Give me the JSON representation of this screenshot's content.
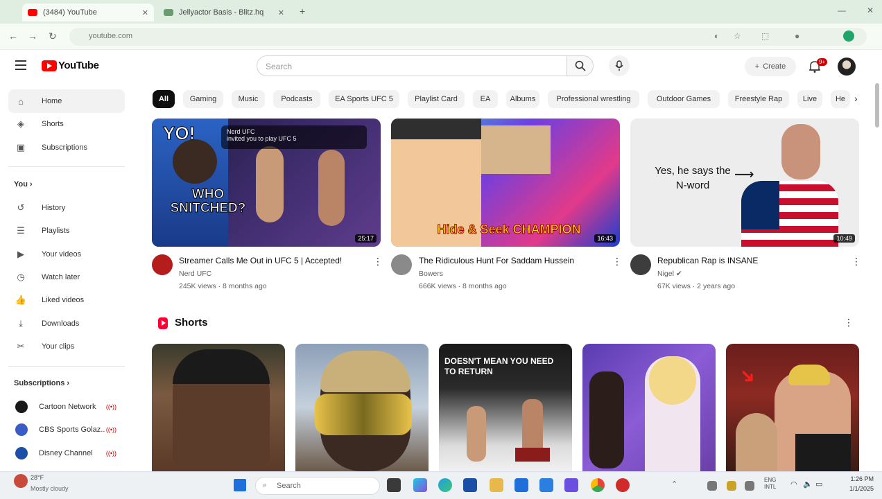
{
  "browser": {
    "tabs": [
      {
        "title": "(3484) YouTube",
        "active": true
      },
      {
        "title": "Jellyactor Basis - Blitz.hq",
        "active": false
      }
    ],
    "url": "youtube.com"
  },
  "header": {
    "logo_text": "YouTube",
    "search_placeholder": "Search",
    "create_label": "Create",
    "notification_count": "9+"
  },
  "sidebar": {
    "main": [
      {
        "label": "Home",
        "icon": "home-icon",
        "active": true
      },
      {
        "label": "Shorts",
        "icon": "shorts-icon"
      },
      {
        "label": "Subscriptions",
        "icon": "subscriptions-icon"
      }
    ],
    "you_heading": "You",
    "you_items": [
      {
        "label": "History",
        "icon": "history-icon"
      },
      {
        "label": "Playlists",
        "icon": "playlists-icon"
      },
      {
        "label": "Your videos",
        "icon": "your-videos-icon"
      },
      {
        "label": "Watch later",
        "icon": "watch-later-icon"
      },
      {
        "label": "Liked videos",
        "icon": "liked-videos-icon"
      },
      {
        "label": "Downloads",
        "icon": "downloads-icon"
      },
      {
        "label": "Your clips",
        "icon": "clips-icon"
      }
    ],
    "subscriptions_heading": "Subscriptions",
    "subscriptions": [
      {
        "label": "Cartoon Network",
        "color": "#1a1a1a",
        "live": "((•))"
      },
      {
        "label": "CBS Sports Golaz..",
        "color": "#3b5cc4",
        "live": "((•))"
      },
      {
        "label": "Disney Channel",
        "color": "#1c4fa8",
        "live": "((•))"
      }
    ]
  },
  "chips": [
    "All",
    "Gaming",
    "Music",
    "Podcasts",
    "EA Sports UFC 5",
    "Playlist Card",
    "EA",
    "Albums",
    "Professional wrestling",
    "Outdoor Games",
    "Freestyle Rap",
    "Live",
    "He"
  ],
  "videos": [
    {
      "title": "Streamer Calls Me Out in UFC 5 | Accepted!",
      "channel": "Nerd UFC",
      "meta": "245K views · 8 months ago",
      "duration": "25:17",
      "thumb_text": "YO!",
      "thumb_text2": "WHO SNITCHED?",
      "overlay_title": "Nerd UFC",
      "overlay_sub": "invited you to play UFC 5"
    },
    {
      "title": "The Ridiculous Hunt For Saddam Hussein",
      "channel": "Bowers",
      "meta": "666K views · 8 months ago",
      "duration": "16:43",
      "thumb_text": "Hide & Seek CHAMPION"
    },
    {
      "title": "Republican Rap is INSANE",
      "channel": "Nigel",
      "meta": "67K views · 2 years ago",
      "duration": "10:49",
      "thumb_text": "Yes, he says the N-word"
    }
  ],
  "shorts": {
    "title": "Shorts",
    "items": [
      {
        "overlay": ""
      },
      {
        "overlay": ""
      },
      {
        "overlay": "DOESN'T MEAN YOU NEED TO RETURN"
      },
      {
        "overlay": ""
      },
      {
        "overlay": ""
      }
    ]
  },
  "taskbar": {
    "weather_temp": "28°F",
    "weather_desc": "Mostly cloudy",
    "search_placeholder": "Search",
    "time": "1:26 PM",
    "date": "1/1/2025",
    "lang": "ENG\nINTL"
  },
  "colors": {
    "brand": "#ff0000",
    "chip_active": "#0f0f0f",
    "chrome_bg": "#dfeee0"
  }
}
